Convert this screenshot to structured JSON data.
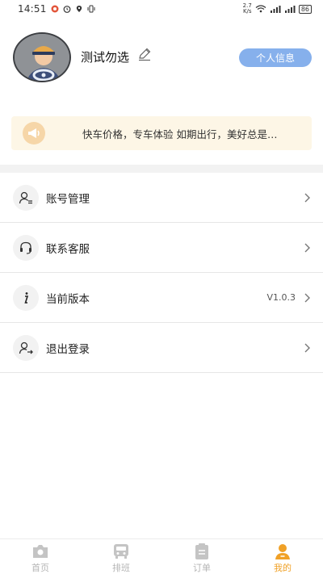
{
  "status_bar": {
    "time": "14:51",
    "net_speed_value": "2.7",
    "net_speed_unit": "K/s",
    "battery": "86"
  },
  "profile": {
    "username": "测试勿选",
    "info_button_label": "个人信息"
  },
  "notice": {
    "text": "快车价格，专车体验 如期出行，美好总是…"
  },
  "menu": {
    "items": [
      {
        "label": "账号管理",
        "value": ""
      },
      {
        "label": "联系客服",
        "value": ""
      },
      {
        "label": "当前版本",
        "value": "V1.0.3"
      },
      {
        "label": "退出登录",
        "value": ""
      }
    ]
  },
  "tabbar": {
    "tabs": [
      {
        "label": "首页",
        "icon": "camera-home-icon"
      },
      {
        "label": "排班",
        "icon": "bus-icon"
      },
      {
        "label": "订单",
        "icon": "clipboard-icon"
      },
      {
        "label": "我的",
        "icon": "user-icon"
      }
    ],
    "active_tab": "我的"
  },
  "colors": {
    "accent": "#f0a127",
    "info_button": "#86b0ec",
    "notice_bg": "#fdf6e6",
    "inactive_tab": "#b5b5b5"
  }
}
